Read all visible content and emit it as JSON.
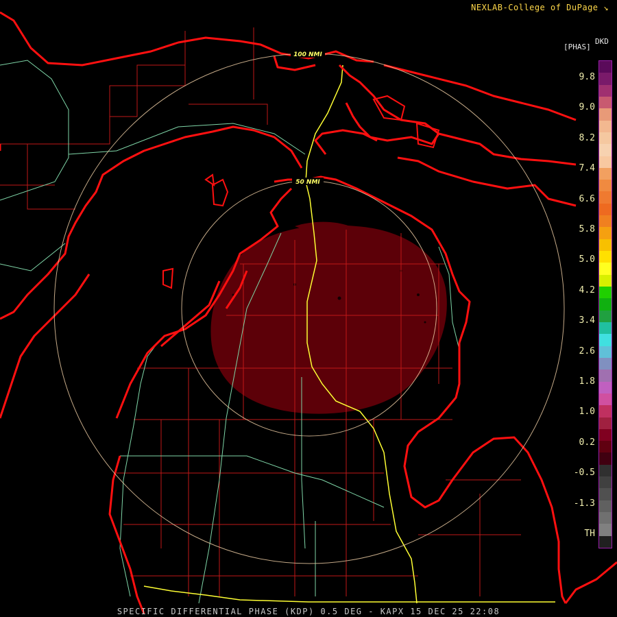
{
  "credit": "NEXLAB-College of DuPage",
  "credit_icon": "expand-icon",
  "product": {
    "unit": "[PHAS]",
    "variable": "DKD"
  },
  "colorbar": {
    "ticks": [
      "9.8",
      "9.0",
      "8.2",
      "7.4",
      "6.6",
      "5.8",
      "5.0",
      "4.2",
      "3.4",
      "2.6",
      "1.8",
      "1.0",
      "0.2",
      "-0.5",
      "-1.3",
      "TH"
    ],
    "colors": [
      "#5a0a5a",
      "#7a1a6a",
      "#a03070",
      "#c85a70",
      "#e89a78",
      "#f3b890",
      "#f5c8a0",
      "#f7d2b0",
      "#f8c8a0",
      "#f2a060",
      "#f08a40",
      "#ef7a30",
      "#ee6a20",
      "#f08020",
      "#f5a010",
      "#f8c000",
      "#ffe000",
      "#ffff20",
      "#d8f000",
      "#20d000",
      "#10b010",
      "#20a040",
      "#20c0a0",
      "#40e0e0",
      "#60c0d8",
      "#8090c0",
      "#a070b0",
      "#c060c0",
      "#d050a0",
      "#c03060",
      "#a02040",
      "#800020",
      "#600010",
      "#400010",
      "#303030",
      "#404040",
      "#505050",
      "#606060",
      "#707070",
      "#808080",
      "#202020"
    ]
  },
  "range_rings": [
    "100 NMI",
    "50 NMI"
  ],
  "footer": "SPECIFIC DIFFERENTIAL PHASE (KDP) 0.5 DEG - KAPX 15 DEC 25 22:08",
  "colors": {
    "shoreline": "#ff1010",
    "county_lines": "#c01818",
    "highways_minor": "#7fd6a8",
    "interstate": "#ffff33",
    "rings": "#e8c8a0",
    "echo": "#5c0008"
  }
}
